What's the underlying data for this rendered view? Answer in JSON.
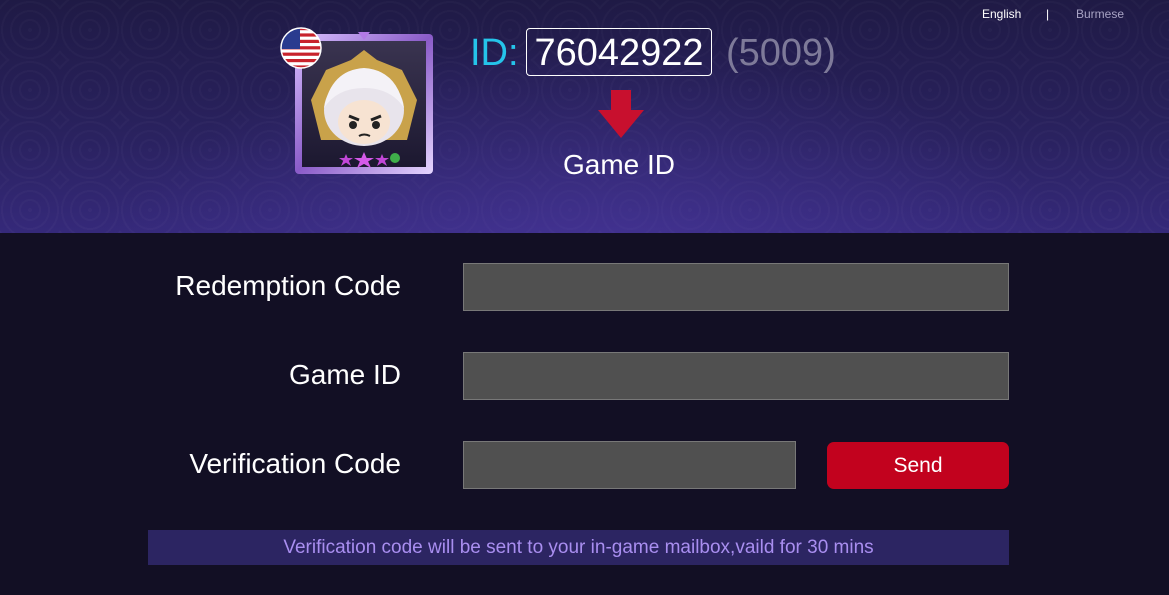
{
  "language_switch": {
    "english": "English",
    "separator": "|",
    "burmese": "Burmese"
  },
  "player": {
    "flag_icon": "us-flag-icon",
    "avatar_icon": "hero-avatar-icon",
    "id_prefix": "ID:",
    "id_value": "76042922",
    "server": "(5009)",
    "arrow_icon": "down-arrow-icon",
    "caption": "Game ID"
  },
  "form": {
    "redemption_label": "Redemption Code",
    "redemption_value": "",
    "game_id_label": "Game ID",
    "game_id_value": "",
    "verification_label": "Verification Code",
    "verification_value": "",
    "send_label": "Send"
  },
  "notice": "Verification code will be sent to your in-game mailbox,vaild for 30 mins",
  "colors": {
    "id_accent": "#25c4ea",
    "send_button": "#c2021e",
    "notice_bg": "#2c2562",
    "notice_text": "#a98ef0"
  }
}
